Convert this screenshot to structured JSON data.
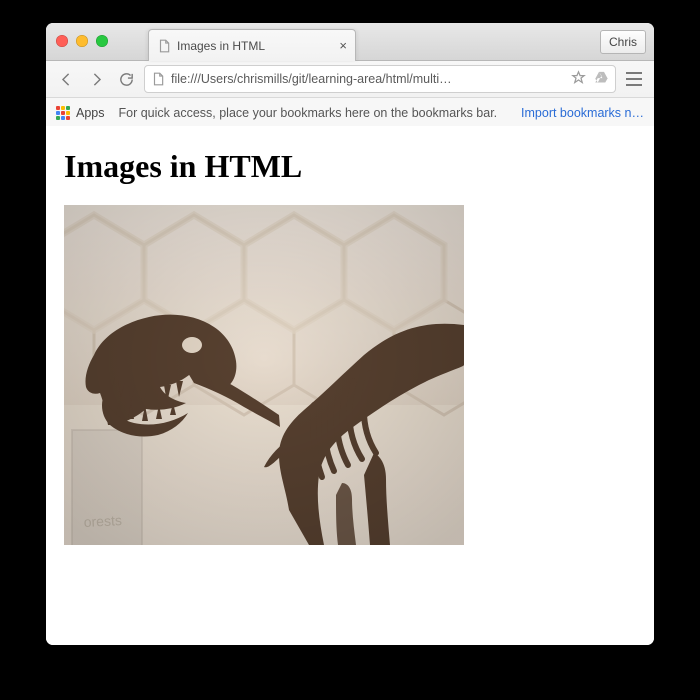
{
  "tab": {
    "title": "Images in HTML"
  },
  "profile": {
    "name": "Chris"
  },
  "toolbar": {
    "url": "file:///Users/chrismills/git/learning-area/html/multi…"
  },
  "bookmarks": {
    "apps_label": "Apps",
    "hint": "For quick access, place your bookmarks here on the bookmarks bar.",
    "import_link": "Import bookmarks n…"
  },
  "page": {
    "heading": "Images in HTML",
    "image_alt": "Tyrannosaurus rex skeleton on display in a museum hall with an ornate coffered ceiling"
  }
}
